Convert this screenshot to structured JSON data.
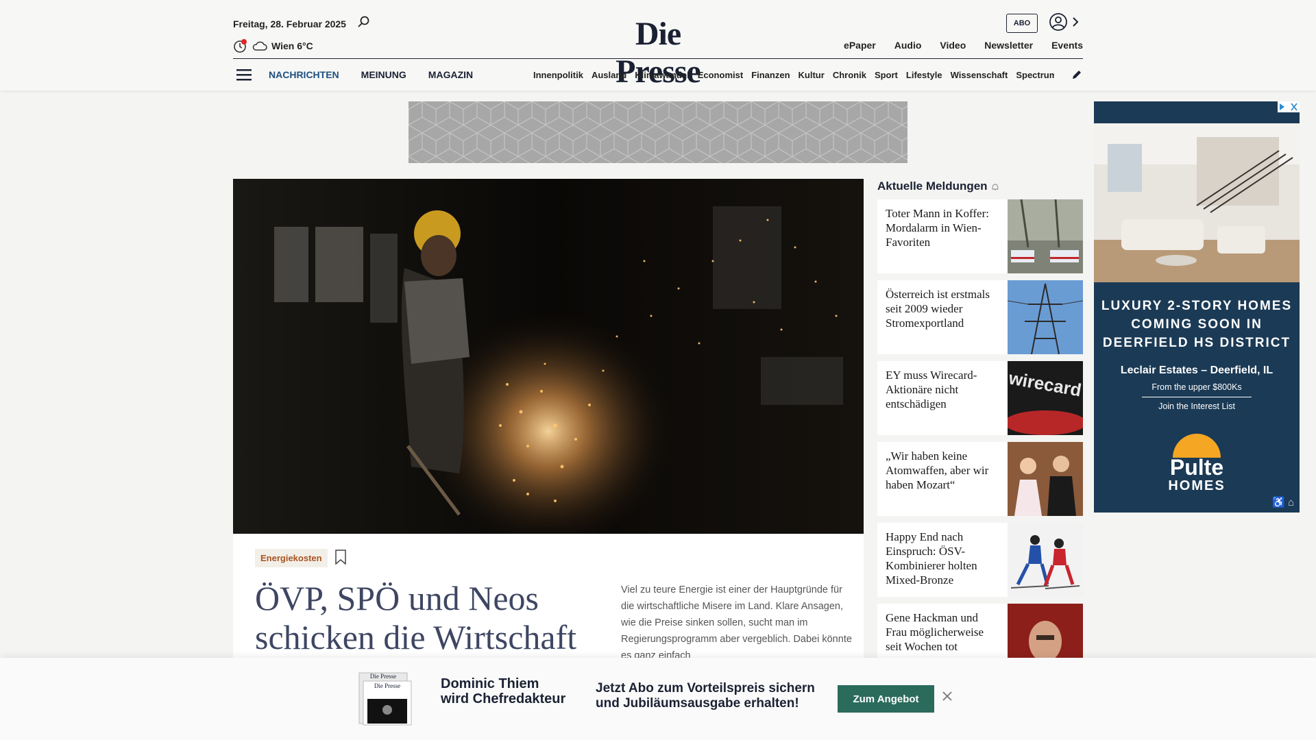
{
  "header": {
    "date": "Freitag, 28. Februar 2025",
    "weather": "Wien 6°C",
    "logo": "Die Presse",
    "abo_label": "ABO",
    "top_links": [
      "ePaper",
      "Audio",
      "Video",
      "Newsletter",
      "Events"
    ],
    "main_nav": [
      "NACHRICHTEN",
      "MEINUNG",
      "MAGAZIN"
    ],
    "sub_nav": [
      "Innenpolitik",
      "Ausland",
      "Klimawandel",
      "Economist",
      "Finanzen",
      "Kultur",
      "Chronik",
      "Sport",
      "Lifestyle",
      "Wissenschaft",
      "Spectrum"
    ]
  },
  "article": {
    "tag": "Energiekosten",
    "headline": "ÖVP, SPÖ und Neos schicken die Wirtschaft",
    "teaser": "Viel zu teure Energie ist einer der Hauptgründe für die wirtschaftliche Misere im Land. Klare Ansagen, wie die Preise sinken sollen, sucht man im Regierungsprogramm aber vergeblich. Dabei könnte es ganz einfach"
  },
  "news": {
    "title": "Aktuelle Meldungen",
    "items": [
      {
        "text": "Toter Mann in Koffer: Mordalarm in Wien-Favoriten"
      },
      {
        "text": "Österreich ist erstmals seit 2009 wieder Stromexportland"
      },
      {
        "text": "EY muss Wirecard-Aktionäre nicht entschädigen"
      },
      {
        "text": "„Wir haben keine Atomwaffen, aber wir haben Mozart“"
      },
      {
        "text": "Happy End nach Einspruch: ÖSV-Kombinierer holten Mixed-Bronze"
      },
      {
        "text": "Gene Hackman und Frau möglicherweise seit Wochen tot"
      }
    ]
  },
  "ad": {
    "headline_lines": [
      "LUXURY 2-STORY HOMES",
      "COMING SOON IN",
      "DEERFIELD HS DISTRICT"
    ],
    "sub": "Leclair Estates – Deerfield, IL",
    "price": "From the upper $800Ks",
    "cta": "Join the Interest List",
    "brand_top": "Pulte",
    "brand_bottom": "HOMES"
  },
  "promo": {
    "name_line1": "Dominic Thiem",
    "name_line2": "wird Chefredakteur",
    "text_line1": "Jetzt Abo zum Vorteilspreis sichern",
    "text_line2": "und Jubiläumsausgabe erhalten!",
    "button": "Zum Angebot",
    "paper_logo": "Die Presse"
  },
  "colors": {
    "brand_navy": "#1a2133",
    "nav_active": "#1d4f80",
    "tag_text": "#a9541e",
    "promo_button": "#2b6b5c",
    "ad_background": "#1b3a55"
  }
}
